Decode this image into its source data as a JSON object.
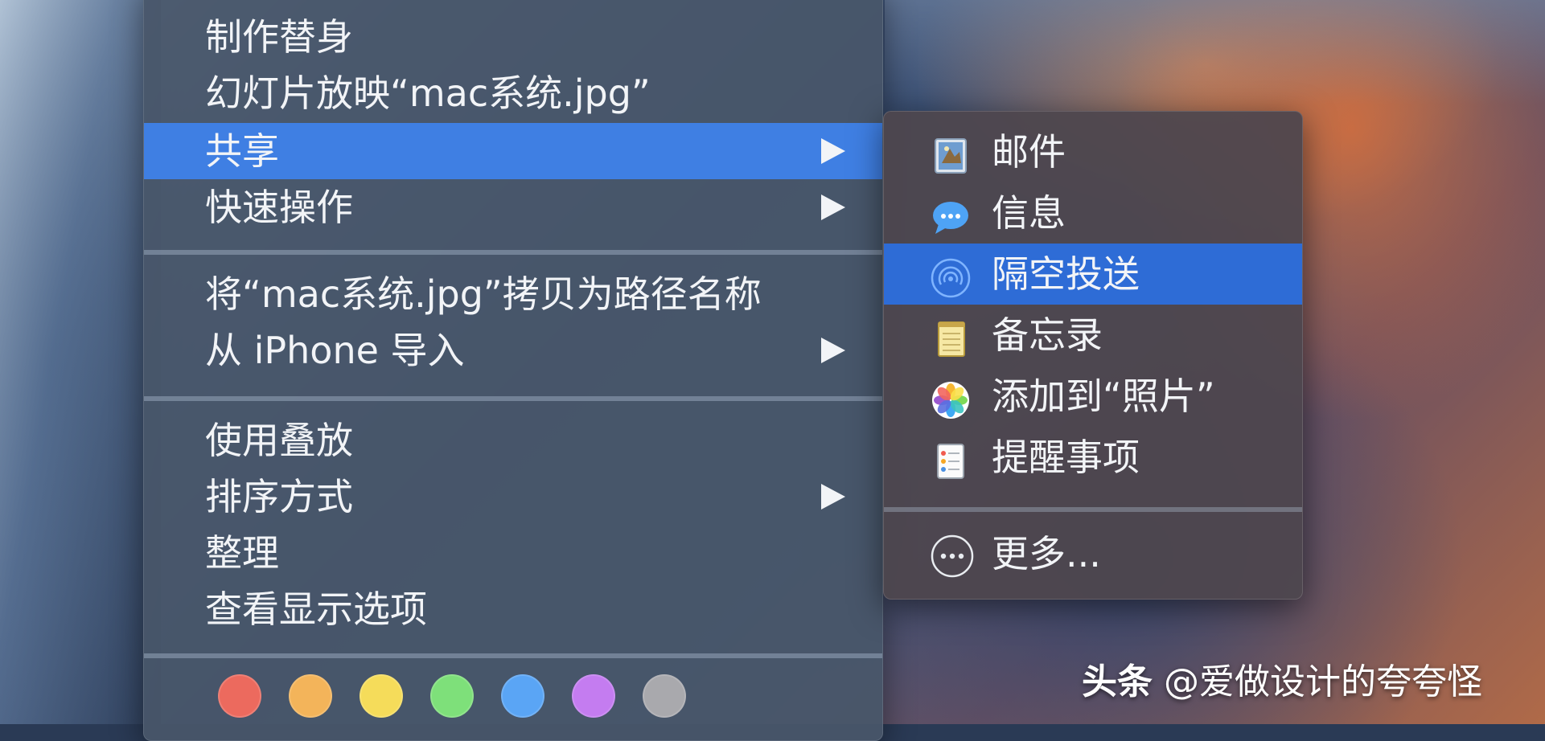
{
  "main_menu": {
    "items": [
      {
        "label": "制作替身",
        "submenu": false
      },
      {
        "label": "幻灯片放映“mac系统.jpg”",
        "submenu": false
      },
      {
        "label": "共享",
        "submenu": true,
        "highlighted": true
      },
      {
        "label": "快速操作",
        "submenu": true
      },
      {
        "label": "将“mac系统.jpg”拷贝为路径名称",
        "submenu": false
      },
      {
        "label": "从 iPhone 导入",
        "submenu": true
      },
      {
        "label": "使用叠放",
        "submenu": false
      },
      {
        "label": "排序方式",
        "submenu": true
      },
      {
        "label": "整理",
        "submenu": false
      },
      {
        "label": "查看显示选项",
        "submenu": false
      }
    ],
    "tag_colors": [
      "#ec6a5e",
      "#f3b45a",
      "#f5dc5a",
      "#7ee07a",
      "#5aa5f5",
      "#c47cf0",
      "#a9a9ad"
    ]
  },
  "share_menu": {
    "items": [
      {
        "label": "邮件",
        "icon": "mail-icon"
      },
      {
        "label": "信息",
        "icon": "messages-icon"
      },
      {
        "label": "隔空投送",
        "icon": "airdrop-icon",
        "highlighted": true
      },
      {
        "label": "备忘录",
        "icon": "notes-icon"
      },
      {
        "label": "添加到“照片”",
        "icon": "photos-icon"
      },
      {
        "label": "提醒事项",
        "icon": "reminders-icon"
      }
    ],
    "more_label": "更多...",
    "more_icon": "more-icon"
  },
  "watermark": {
    "brand": "头条",
    "handle": "@爱做设计的夸夸怪"
  },
  "colors": {
    "highlight": "#3f7fe3",
    "submenu_highlight": "#2e6cd6"
  }
}
